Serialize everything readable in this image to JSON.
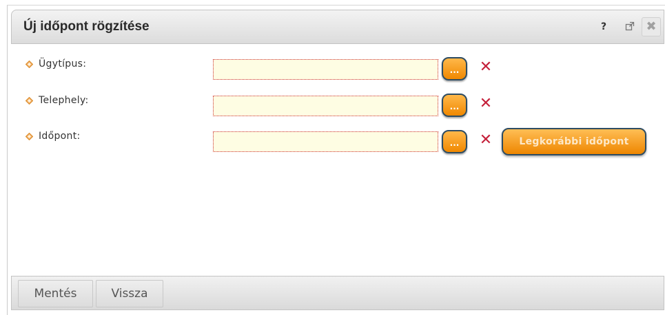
{
  "dialog": {
    "title": "Új időpont rögzítése",
    "help_label": "?",
    "popout_icon": "popout-icon",
    "close_label": "✖"
  },
  "form": {
    "rows": [
      {
        "label": "Ügytípus:",
        "value": "",
        "picker_label": "...",
        "clear_label": "✕"
      },
      {
        "label": "Telephely:",
        "value": "",
        "picker_label": "...",
        "clear_label": "✕"
      },
      {
        "label": "Időpont:",
        "value": "",
        "picker_label": "...",
        "clear_label": "✕"
      }
    ],
    "earliest_button_label": "Legkorábbi időpont"
  },
  "footer": {
    "save_label": "Mentés",
    "back_label": "Vissza"
  },
  "colors": {
    "accent_orange": "#f08800",
    "required_border": "#cc2a2a",
    "field_background": "#fefde3",
    "clear_icon": "#c4203a"
  }
}
